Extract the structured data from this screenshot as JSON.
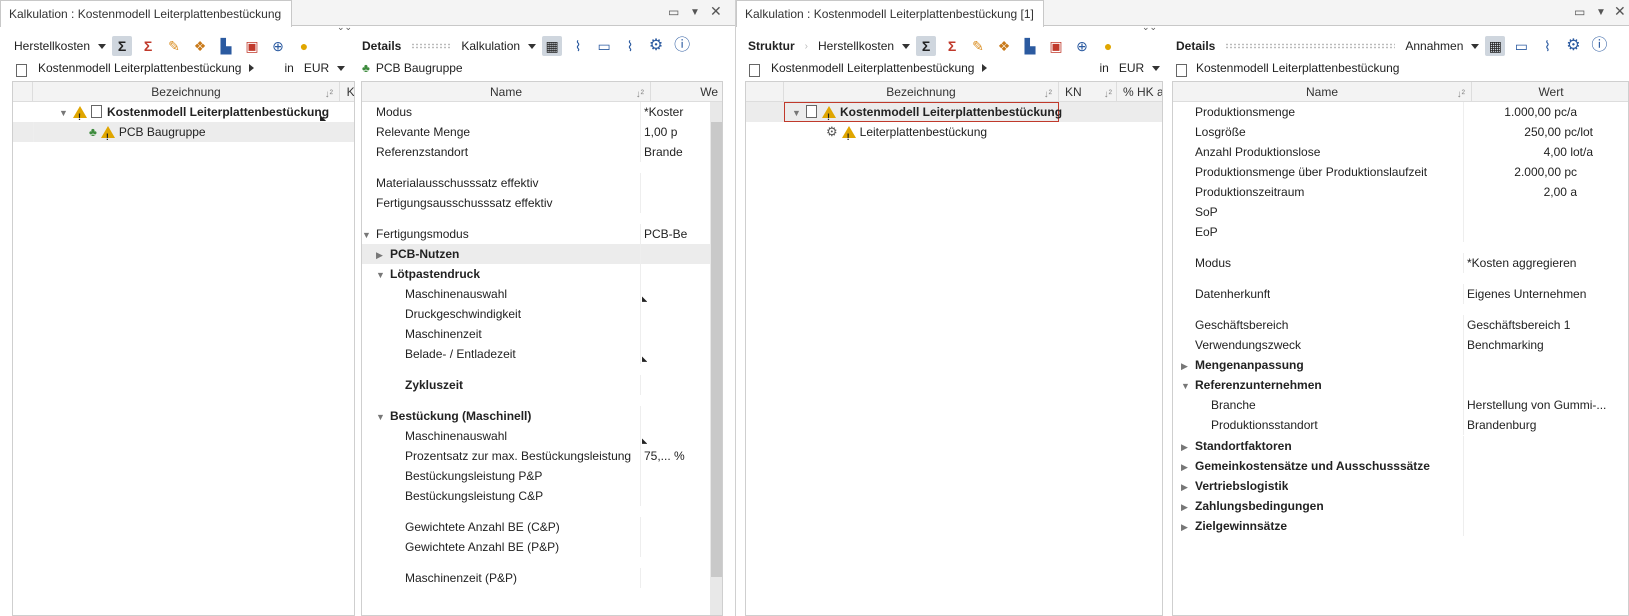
{
  "left_window": {
    "tab_title": "Kalkulation : Kostenmodell Leiterplattenbestückung",
    "struct_panel": {
      "cost_dropdown": "Herstellkosten",
      "breadcrumb": "Kostenmodell Leiterplattenbestückung",
      "currency_in": "in",
      "currency": "EUR",
      "columns": [
        "Bezeichnung",
        "KN"
      ],
      "rows": [
        {
          "label": "Kostenmodell Leiterplattenbestückung",
          "bold": true
        },
        {
          "label": "PCB Baugruppe",
          "bold": false
        }
      ]
    },
    "details_panel": {
      "title": "Details",
      "mode_dropdown": "Kalkulation",
      "subtitle": "PCB Baugruppe",
      "columns": [
        "Name",
        "We"
      ],
      "rows": [
        {
          "name": "Modus",
          "value": "*Koster"
        },
        {
          "name": "Relevante Menge",
          "value": "1,00 p"
        },
        {
          "name": "Referenzstandort",
          "value": "Brande"
        },
        {
          "name": "Materialausschusssatz effektiv",
          "value": ""
        },
        {
          "name": "Fertigungsausschusssatz effektiv",
          "value": ""
        },
        {
          "name": "Fertigungsmodus",
          "value": "PCB-Be"
        },
        {
          "name": "PCB-Nutzen",
          "value": ""
        },
        {
          "name": "Lötpastendruck",
          "value": ""
        },
        {
          "name": "Maschinenauswahl",
          "value": ""
        },
        {
          "name": "Druckgeschwindigkeit",
          "value": ""
        },
        {
          "name": "Maschinenzeit",
          "value": ""
        },
        {
          "name": "Belade- / Entladezeit",
          "value": ""
        },
        {
          "name": "Zykluszeit",
          "value": ""
        },
        {
          "name": "Bestückung (Maschinell)",
          "value": ""
        },
        {
          "name": "Maschinenauswahl",
          "value": ""
        },
        {
          "name": "Prozentsatz zur max. Bestückungsleistung",
          "value": "75,... %"
        },
        {
          "name": "Bestückungsleistung P&P",
          "value": ""
        },
        {
          "name": "Bestückungsleistung C&P",
          "value": ""
        },
        {
          "name": "Gewichtete Anzahl BE (C&P)",
          "value": ""
        },
        {
          "name": "Gewichtete Anzahl BE (P&P)",
          "value": ""
        },
        {
          "name": "Maschinenzeit (P&P)",
          "value": ""
        }
      ]
    }
  },
  "right_window": {
    "tab_title": "Kalkulation : Kostenmodell Leiterplattenbestückung [1]",
    "struct_panel": {
      "title": "Struktur",
      "cost_dropdown": "Herstellkosten",
      "breadcrumb": "Kostenmodell Leiterplattenbestückung",
      "currency_in": "in",
      "currency": "EUR",
      "columns": [
        "Bezeichnung",
        "KN",
        "% HK a"
      ],
      "rows": [
        {
          "label": "Kostenmodell Leiterplattenbestückung",
          "bold": true
        },
        {
          "label": "Leiterplattenbestückung",
          "bold": false
        }
      ]
    },
    "details_panel": {
      "title": "Details",
      "mode_dropdown": "Annahmen",
      "subtitle": "Kostenmodell Leiterplattenbestückung",
      "columns": [
        "Name",
        "Wert"
      ],
      "rows": [
        {
          "name": "Produktionsmenge",
          "value": "1.000,00 pc/a"
        },
        {
          "name": "Losgröße",
          "value": "250,00 pc/lot"
        },
        {
          "name": "Anzahl Produktionslose",
          "value": "4,00 lot/a"
        },
        {
          "name": "Produktionsmenge über Produktionslaufzeit",
          "value": "2.000,00 pc"
        },
        {
          "name": "Produktionszeitraum",
          "value": "2,00 a"
        },
        {
          "name": "SoP",
          "value": ""
        },
        {
          "name": "EoP",
          "value": ""
        },
        {
          "name": "Modus",
          "value": "*Kosten aggregieren"
        },
        {
          "name": "Datenherkunft",
          "value": "Eigenes Unternehmen"
        },
        {
          "name": "Geschäftsbereich",
          "value": "Geschäftsbereich 1"
        },
        {
          "name": "Verwendungszweck",
          "value": "Benchmarking"
        },
        {
          "name": "Mengenanpassung",
          "value": ""
        },
        {
          "name": "Referenzunternehmen",
          "value": ""
        },
        {
          "name": "Branche",
          "value": "Herstellung von Gummi-..."
        },
        {
          "name": "Produktionsstandort",
          "value": "Brandenburg"
        },
        {
          "name": "Standortfaktoren",
          "value": ""
        },
        {
          "name": "Gemeinkostensätze und Ausschusssätze",
          "value": ""
        },
        {
          "name": "Vertriebslogistik",
          "value": ""
        },
        {
          "name": "Zahlungsbedingungen",
          "value": ""
        },
        {
          "name": "Zielgewinnsätze",
          "value": ""
        }
      ]
    }
  },
  "accent_color": "#c0392b",
  "selection_color": "#cfd6de"
}
